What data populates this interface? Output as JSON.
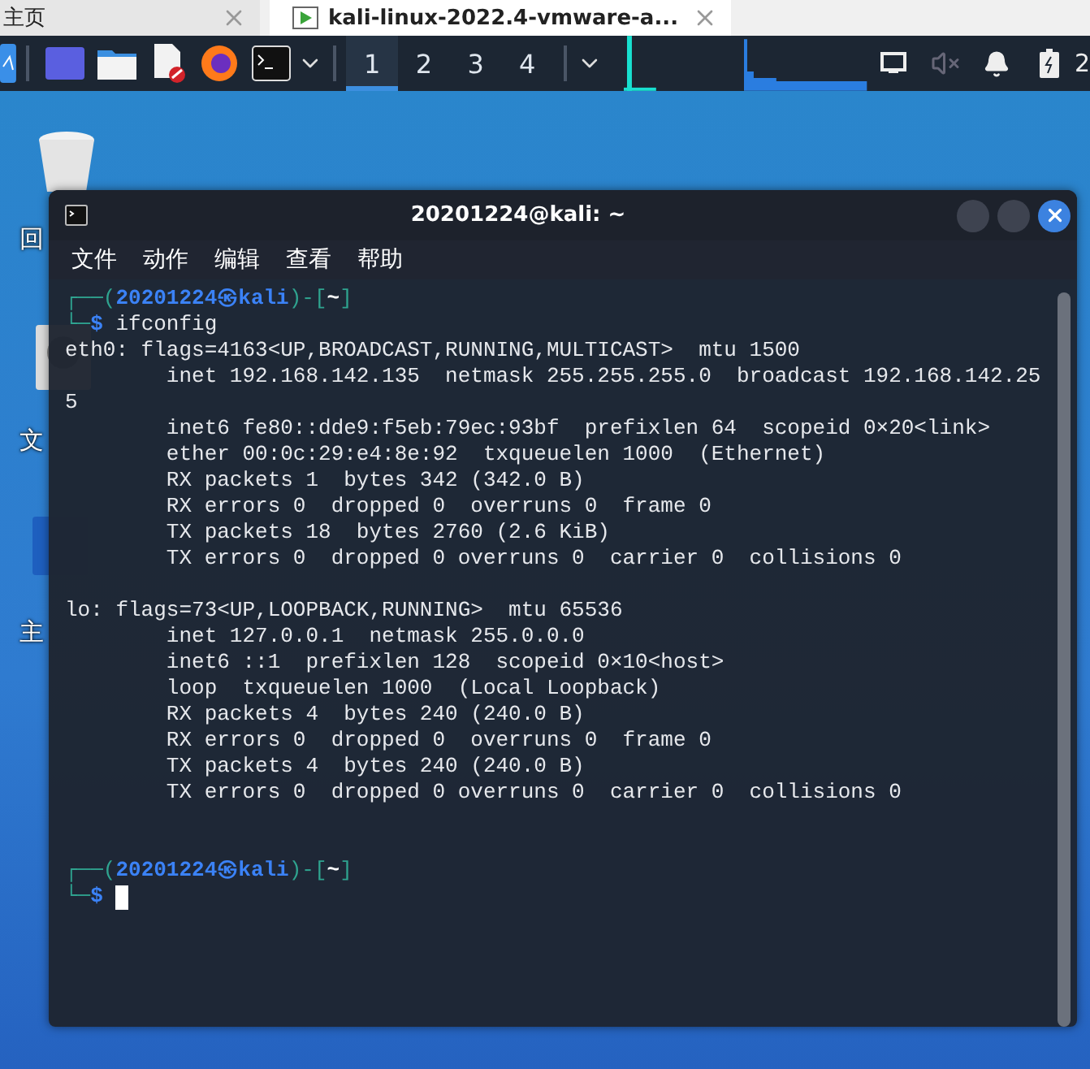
{
  "browser_tabs": [
    {
      "label": "主页",
      "selected": false
    },
    {
      "label": "kali-linux-2022.4-vmware-a...",
      "selected": true
    }
  ],
  "taskbar": {
    "workspaces": [
      {
        "label": "1",
        "selected": true
      },
      {
        "label": "2",
        "selected": false
      },
      {
        "label": "3",
        "selected": false
      },
      {
        "label": "4",
        "selected": false
      }
    ],
    "clock": "2"
  },
  "desktop_icons": [
    {
      "kind": "trash",
      "label": "回"
    },
    {
      "kind": "drive",
      "label": "文"
    },
    {
      "kind": "home",
      "label": "主"
    }
  ],
  "terminal": {
    "title": "20201224@kali: ~",
    "menu": [
      "文件",
      "动作",
      "编辑",
      "查看",
      "帮助"
    ],
    "lines": [
      {
        "kind": "prompt",
        "frame_top": "┌──(",
        "user": "20201224",
        "separator": "㉿",
        "host": "kali",
        "middle": ")-[",
        "cwd": "~",
        "close": "]",
        "frame_bottom": "└─",
        "symbol": "$",
        "command": "ifconfig"
      },
      {
        "kind": "output",
        "text": "eth0: flags=4163<UP,BROADCAST,RUNNING,MULTICAST>  mtu 1500"
      },
      {
        "kind": "output",
        "text": "        inet 192.168.142.135  netmask 255.255.255.0  broadcast 192.168.142.25"
      },
      {
        "kind": "output",
        "text": "5"
      },
      {
        "kind": "output",
        "text": "        inet6 fe80::dde9:f5eb:79ec:93bf  prefixlen 64  scopeid 0×20<link>"
      },
      {
        "kind": "output",
        "text": "        ether 00:0c:29:e4:8e:92  txqueuelen 1000  (Ethernet)"
      },
      {
        "kind": "output",
        "text": "        RX packets 1  bytes 342 (342.0 B)"
      },
      {
        "kind": "output",
        "text": "        RX errors 0  dropped 0  overruns 0  frame 0"
      },
      {
        "kind": "output",
        "text": "        TX packets 18  bytes 2760 (2.6 KiB)"
      },
      {
        "kind": "output",
        "text": "        TX errors 0  dropped 0 overruns 0  carrier 0  collisions 0"
      },
      {
        "kind": "blank"
      },
      {
        "kind": "output",
        "text": "lo: flags=73<UP,LOOPBACK,RUNNING>  mtu 65536"
      },
      {
        "kind": "output",
        "text": "        inet 127.0.0.1  netmask 255.0.0.0"
      },
      {
        "kind": "output",
        "text": "        inet6 ::1  prefixlen 128  scopeid 0×10<host>"
      },
      {
        "kind": "output",
        "text": "        loop  txqueuelen 1000  (Local Loopback)"
      },
      {
        "kind": "output",
        "text": "        RX packets 4  bytes 240 (240.0 B)"
      },
      {
        "kind": "output",
        "text": "        RX errors 0  dropped 0  overruns 0  frame 0"
      },
      {
        "kind": "output",
        "text": "        TX packets 4  bytes 240 (240.0 B)"
      },
      {
        "kind": "output",
        "text": "        TX errors 0  dropped 0 overruns 0  carrier 0  collisions 0"
      },
      {
        "kind": "blank"
      },
      {
        "kind": "blank"
      },
      {
        "kind": "prompt",
        "frame_top": "┌──(",
        "user": "20201224",
        "separator": "㉿",
        "host": "kali",
        "middle": ")-[",
        "cwd": "~",
        "close": "]",
        "frame_bottom": "└─",
        "symbol": "$",
        "cursor": true
      }
    ]
  }
}
